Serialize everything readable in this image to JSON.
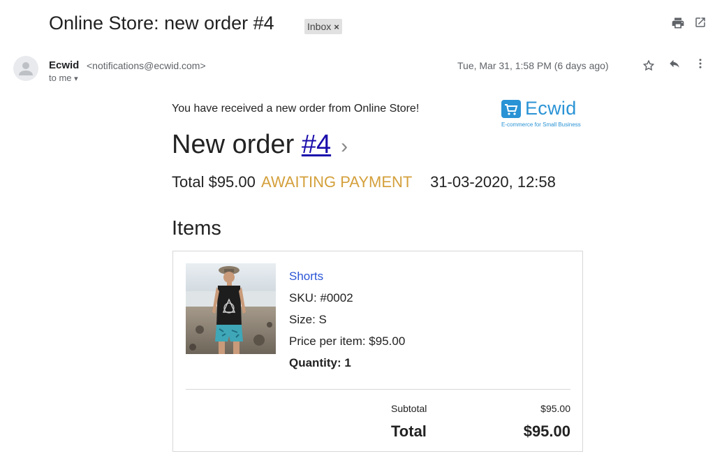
{
  "header": {
    "subject": "Online Store: new order #4",
    "label_chip": "Inbox",
    "label_remove": "×"
  },
  "sender": {
    "name": "Ecwid",
    "email": "<notifications@ecwid.com>",
    "to": "to me",
    "to_arrow": "▾",
    "date": "Tue, Mar 31, 1:58 PM (6 days ago)"
  },
  "message": {
    "intro": "You have received a new order from Online Store!",
    "logo_name": "Ecwid",
    "logo_tagline": "E-commerce for Small Business",
    "title_prefix": "New order ",
    "order_link": "#4",
    "chevron": "›",
    "total_text": "Total $95.00",
    "status": "AWAITING PAYMENT",
    "datetime": "31-03-2020, 12:58",
    "items_heading": "Items",
    "item": {
      "name": "Shorts",
      "sku": "SKU: #0002",
      "size": "Size: S",
      "price": "Price per item: $95.00",
      "quantity": "Quantity: 1"
    },
    "summary": {
      "subtotal_label": "Subtotal",
      "subtotal_value": "$95.00",
      "total_label": "Total",
      "total_value": "$95.00"
    }
  },
  "colors": {
    "status": "#d4a03c",
    "link": "#1a0dab",
    "item_link": "#2b56d6",
    "brand": "#2a93d5"
  },
  "icons": [
    "print-icon",
    "open-in-new-window-icon",
    "star-icon",
    "reply-icon",
    "more-vertical-icon",
    "cart-logo-icon",
    "person-icon"
  ]
}
